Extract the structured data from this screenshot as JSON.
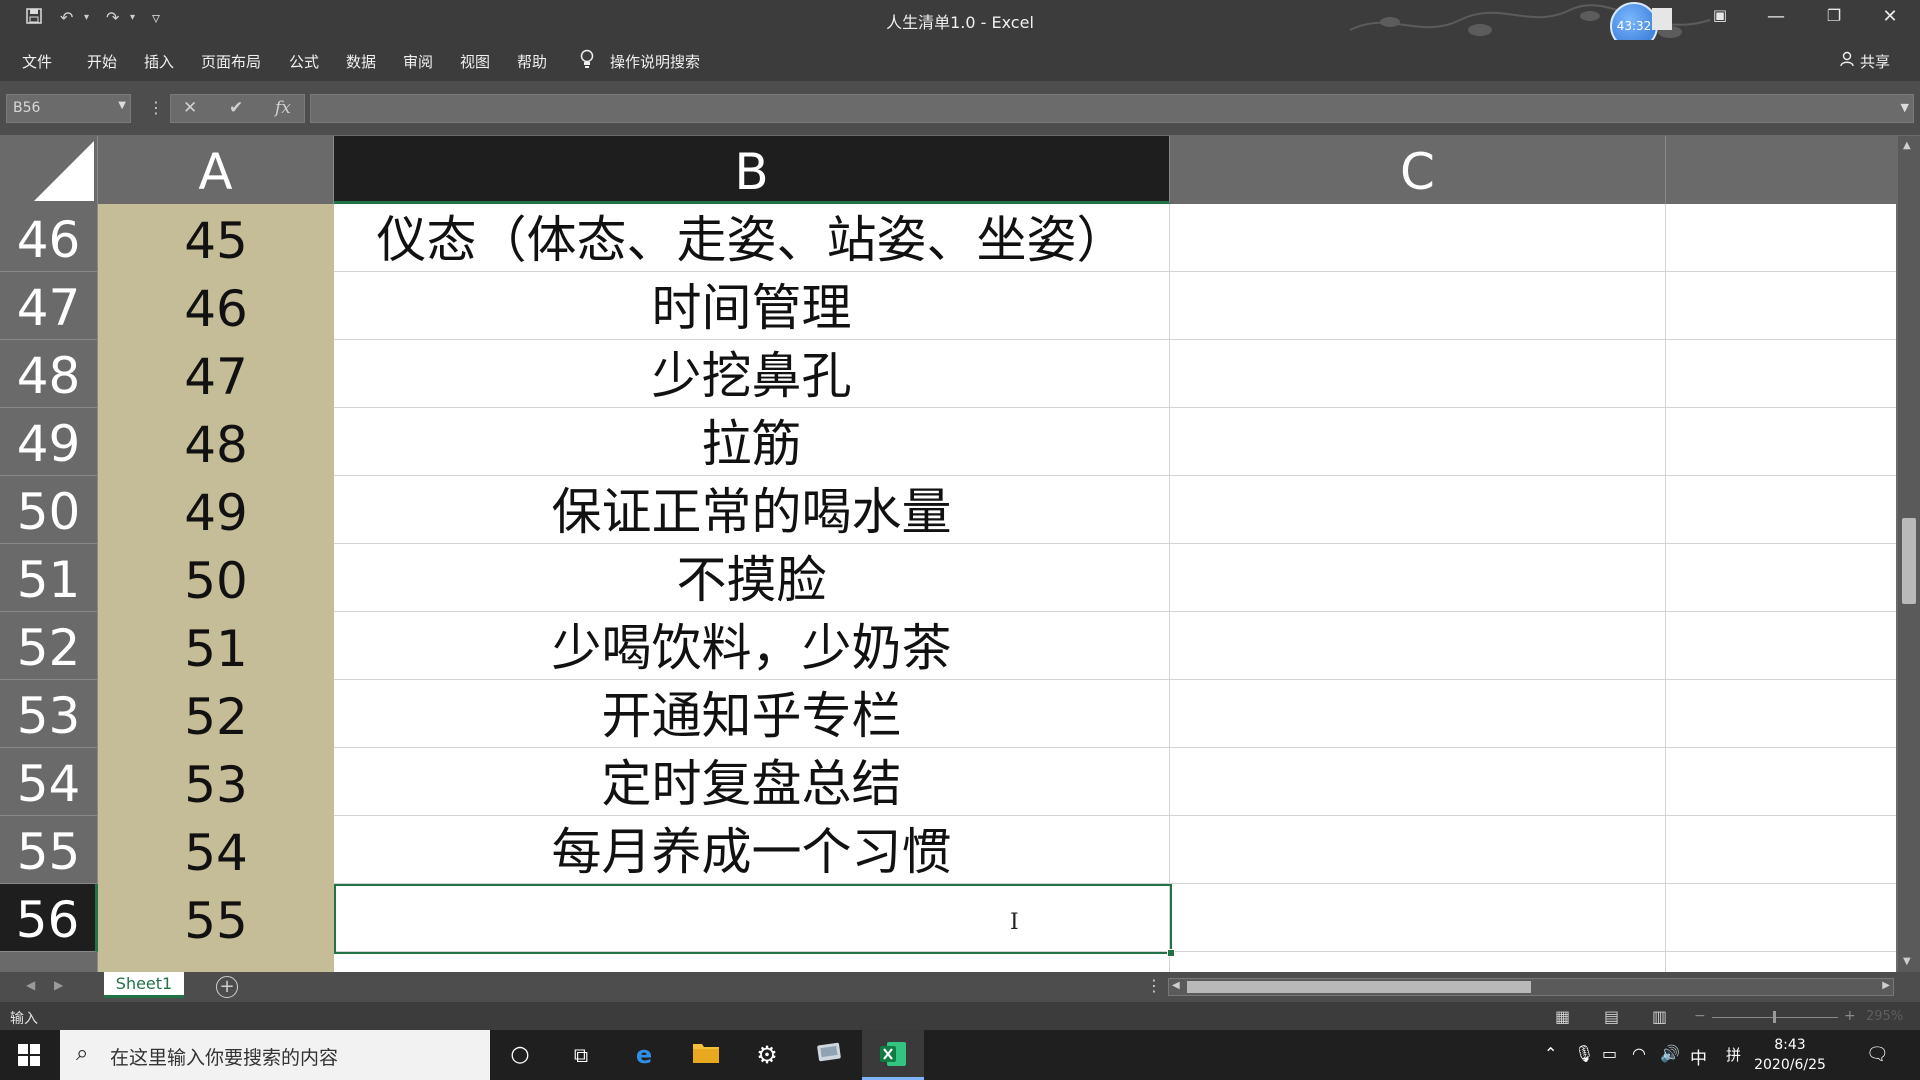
{
  "window": {
    "title": "人生清单1.0  -  Excel",
    "timer": "43:32",
    "buttons": {
      "minimize": "—",
      "restore": "❐",
      "close": "✕"
    }
  },
  "quick_access": {
    "save_icon": "save-icon",
    "undo": "↶",
    "redo": "↷",
    "customize": "▿"
  },
  "ribbon_tabs": [
    "文件",
    "开始",
    "插入",
    "页面布局",
    "公式",
    "数据",
    "审阅",
    "视图",
    "帮助"
  ],
  "tell_me": "操作说明搜索",
  "share": "共享",
  "formula_bar": {
    "name_box": "B56",
    "cancel": "✕",
    "enter": "✔",
    "fx": "fx",
    "value": ""
  },
  "columns": [
    "A",
    "B",
    "C"
  ],
  "rows": [
    {
      "row": "46",
      "a": "45",
      "b": "仪态（体态、走姿、站姿、坐姿）"
    },
    {
      "row": "47",
      "a": "46",
      "b": "时间管理"
    },
    {
      "row": "48",
      "a": "47",
      "b": "少挖鼻孔"
    },
    {
      "row": "49",
      "a": "48",
      "b": "拉筋"
    },
    {
      "row": "50",
      "a": "49",
      "b": "保证正常的喝水量"
    },
    {
      "row": "51",
      "a": "50",
      "b": "不摸脸"
    },
    {
      "row": "52",
      "a": "51",
      "b": "少喝饮料，少奶茶"
    },
    {
      "row": "53",
      "a": "52",
      "b": "开通知乎专栏"
    },
    {
      "row": "54",
      "a": "53",
      "b": "定时复盘总结"
    },
    {
      "row": "55",
      "a": "54",
      "b": "每月养成一个习惯"
    },
    {
      "row": "56",
      "a": "55",
      "b": ""
    }
  ],
  "selected_cell": {
    "row": "56",
    "column": "B"
  },
  "sheet_tabs": [
    "Sheet1"
  ],
  "status": {
    "mode": "输入",
    "zoom": "295%"
  },
  "taskbar": {
    "search_placeholder": "在这里输入你要搜索的内容",
    "ime": "中",
    "layout": "拼",
    "time": "8:43",
    "date": "2020/6/25"
  },
  "colors": {
    "accent": "#217346",
    "column_a_fill": "#c4bd97",
    "chrome": "#3c3c3c"
  }
}
